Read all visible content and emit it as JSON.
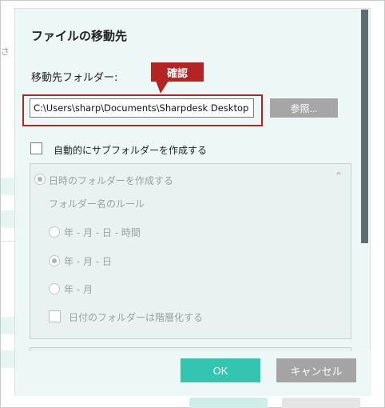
{
  "background": {
    "snippet": "さ"
  },
  "dialog": {
    "title": "ファイルの移動先",
    "folder_label": "移動先フォルダー:",
    "path_value": "C:\\Users\\sharp\\Documents\\Sharpdesk Desktop",
    "browse_label": "参照...",
    "callout": "確認",
    "auto_subfolder_label": "自動的にサブフォルダーを作成する",
    "auto_subfolder_checked": false,
    "date_folder_label": "日時のフォルダーを作成する",
    "rule_label": "フォルダー名のルール",
    "rules": [
      {
        "label": "年 - 月 - 日 - 時間",
        "selected": false
      },
      {
        "label": "年 - 月 - 日",
        "selected": true
      },
      {
        "label": "年 - 月",
        "selected": false
      }
    ],
    "hierarchy_label": "日付のフォルダーは階層化する",
    "ok_label": "OK",
    "cancel_label": "キャンセル"
  },
  "colors": {
    "accent": "#33c5b0",
    "callout": "#b42424",
    "dialog_bg": "#edf7f6"
  }
}
